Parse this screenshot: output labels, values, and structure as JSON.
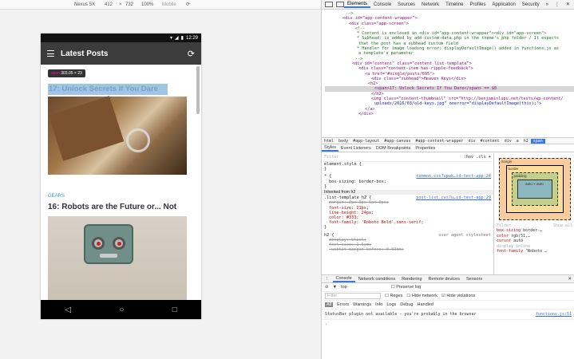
{
  "device_bar": {
    "device": "Nexus 5X",
    "width": "412",
    "height": "732",
    "zoom": "100%",
    "mode": "Mobile"
  },
  "phone": {
    "time": "12:29",
    "app_title": "Latest Posts",
    "tooltip_tag": "span",
    "tooltip_size": "303.05 × 23",
    "post1_title": "17: Unlock Secrets If You Dare",
    "post2_category": "GEARS",
    "post2_title": "16: Robots are the Future or... Not"
  },
  "devtools": {
    "tabs": [
      "Elements",
      "Console",
      "Sources",
      "Network",
      "Timeline",
      "Profiles",
      "Application",
      "Security"
    ],
    "dom_lines": [
      "-->",
      "<div id=\"app-content-wrapper\">",
      "<div class=\"app-screen\">",
      "<!--",
      "* Content is enclosed in <div id=\"app-content-wrapper\"><div id=\"app-screen\">",
      "* Subhead: is added by add-custom-data.php in the theme's php folder / It expects",
      "that the post has a subhead custom field",
      "* Handler for image loading error: displayDefaultImage() added in functions.js as",
      "a template's parameter",
      "-->",
      "<div id=\"content\" class=\"content list-template\">",
      "<div class=\"content-item has-ripple-feedback\">",
      "<a href=\"#single/posts/695\">",
      "<div class=\"subhead\">Heaven Keys</div>",
      "<h2>",
      "<span>17: Unlock Secrets If You Dare</span> == $0",
      "</h2>",
      "<img class=\"content-thumbnail\" src=\"http://benjaminlupu.net/tests/wp-content/",
      "uploads/2016/03/old-keys.jpg\" onerror=\"displayDefaultImage(this);\">",
      "</a>",
      "</div>"
    ],
    "crumbs": [
      "html",
      "body",
      "#app-layout",
      "#app-canvas",
      "#app-content-wrapper",
      "div",
      "#content",
      "div",
      "a",
      "h2",
      "span"
    ],
    "style_tabs": [
      "Styles",
      "Event Listeners",
      "DOM Breakpoints",
      "Properties"
    ],
    "filter_placeholder": "Filter",
    "hov_cls": ":hov .cls +",
    "styles": {
      "element_style": "element.style {",
      "rule1_selector": "* {",
      "rule1_src": "common.css?upak…id-test-app:24",
      "rule1_prop": "box-sizing: border-box;",
      "inherited": "Inherited from h2",
      "rule2_selector": ".list-template h2 {",
      "rule2_src": "post-list.css?u…id-test-app:29",
      "rule2_props": [
        "margin: 0px 0px 5px 0px;",
        "font-size: 21px;",
        "line-height: 24px;",
        "color: #333;",
        "font-family: 'Roboto Bold',sans-serif;"
      ],
      "rule3_selector": "h2 {",
      "rule3_src": "user agent stylesheet",
      "rule3_props": [
        "display: block;",
        "font-size: 1.5em;",
        "-webkit-margin-before: 0.83em;"
      ]
    },
    "box": {
      "margin": "margin",
      "border": "border",
      "padding": "padding",
      "content": "auto × auto"
    },
    "computed": {
      "filter": "Filter",
      "show_all": "Show all",
      "props": [
        {
          "name": "box-sizing",
          "value": "border-…"
        },
        {
          "name": "color",
          "value": "rgb(51,…"
        },
        {
          "name": "cursor",
          "value": "auto"
        },
        {
          "name": "display",
          "value": "inline"
        },
        {
          "name": "font-family",
          "value": "\"Roboto …"
        }
      ]
    },
    "console_tabs": [
      "Console",
      "Network conditions",
      "Rendering",
      "Remote devices",
      "Sensors"
    ],
    "console_context": "top",
    "preserve_log": "Preserve log",
    "console_filter": "Filter",
    "regex": "Regex",
    "hide_network": "Hide network",
    "hide_violations": "Hide violations",
    "levels": [
      "All",
      "Errors",
      "Warnings",
      "Info",
      "Logs",
      "Debug",
      "Handled"
    ],
    "message": "StatusBar plugin not available - you're probably in the browser",
    "message_src": "functions.js:51"
  }
}
